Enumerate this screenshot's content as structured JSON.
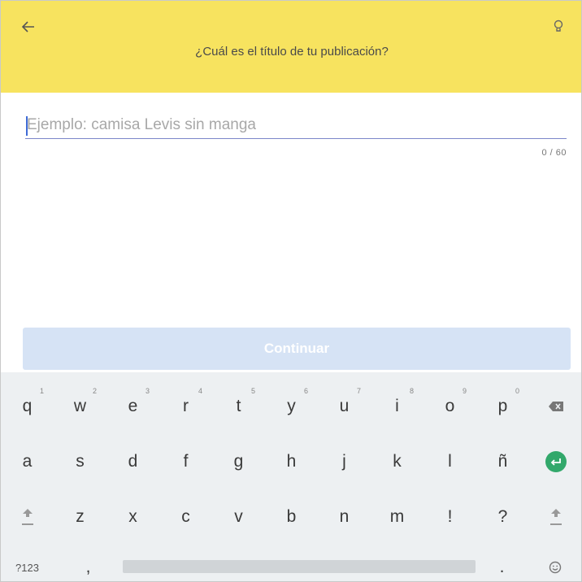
{
  "header": {
    "title": "¿Cuál es el título de tu publicación?",
    "background": "#f7e35f",
    "back_icon": "arrow-left-icon",
    "hint_icon": "lightbulb-icon"
  },
  "form": {
    "placeholder": "Ejemplo: camisa Levis sin manga",
    "value": "",
    "counter": "0 / 60"
  },
  "continue_label": "Continuar",
  "keyboard": {
    "row1": [
      {
        "label": "q",
        "hint": "1"
      },
      {
        "label": "w",
        "hint": "2"
      },
      {
        "label": "e",
        "hint": "3"
      },
      {
        "label": "r",
        "hint": "4"
      },
      {
        "label": "t",
        "hint": "5"
      },
      {
        "label": "y",
        "hint": "6"
      },
      {
        "label": "u",
        "hint": "7"
      },
      {
        "label": "i",
        "hint": "8"
      },
      {
        "label": "o",
        "hint": "9"
      },
      {
        "label": "p",
        "hint": "0"
      }
    ],
    "row2": [
      "a",
      "s",
      "d",
      "f",
      "g",
      "h",
      "j",
      "k",
      "l",
      "ñ"
    ],
    "row3": [
      "z",
      "x",
      "c",
      "v",
      "b",
      "n",
      "m",
      "!",
      "?"
    ],
    "symbols_label": "?123",
    "comma_label": ",",
    "period_label": ".",
    "backspace_icon": "backspace-icon",
    "enter_icon": "enter-icon",
    "shift_icon": "shift-icon",
    "emoji_icon": "emoji-icon",
    "enter_color": "#32a86b"
  }
}
